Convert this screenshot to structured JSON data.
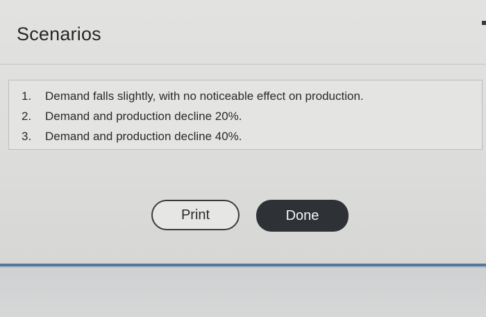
{
  "dialog": {
    "title": "Scenarios"
  },
  "scenarios": {
    "items": [
      {
        "num": "1.",
        "text": "Demand falls slightly, with no noticeable effect on production."
      },
      {
        "num": "2.",
        "text": "Demand and production decline 20%."
      },
      {
        "num": "3.",
        "text": "Demand and production decline 40%."
      }
    ]
  },
  "buttons": {
    "print_label": "Print",
    "done_label": "Done"
  },
  "colors": {
    "background": "#dedede",
    "done_button": "#2e3236",
    "divider": "#55779a",
    "text": "#2a2a2a"
  }
}
